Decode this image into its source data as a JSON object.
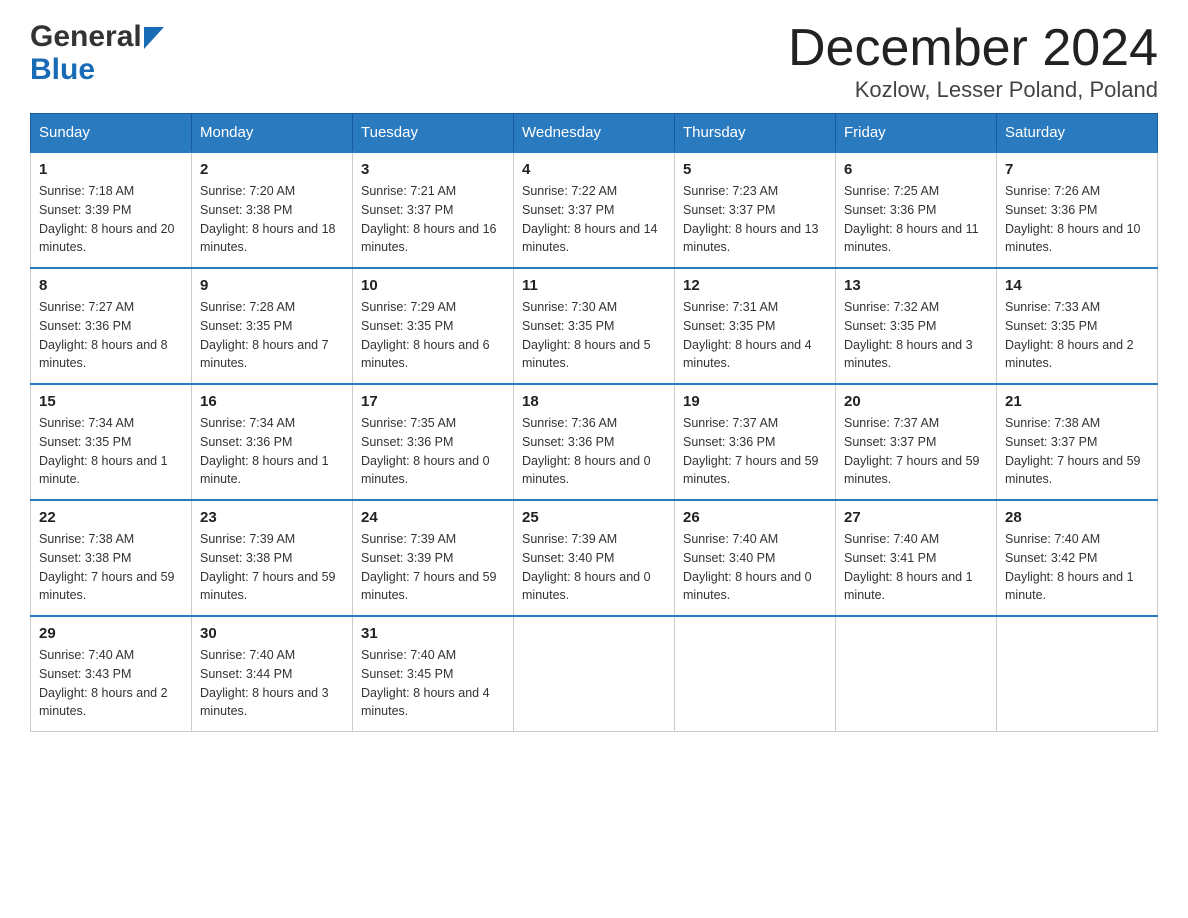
{
  "header": {
    "month_title": "December 2024",
    "location": "Kozlow, Lesser Poland, Poland",
    "logo_general": "General",
    "logo_blue": "Blue"
  },
  "days_of_week": [
    "Sunday",
    "Monday",
    "Tuesday",
    "Wednesday",
    "Thursday",
    "Friday",
    "Saturday"
  ],
  "weeks": [
    [
      {
        "day": "1",
        "sunrise": "Sunrise: 7:18 AM",
        "sunset": "Sunset: 3:39 PM",
        "daylight": "Daylight: 8 hours and 20 minutes."
      },
      {
        "day": "2",
        "sunrise": "Sunrise: 7:20 AM",
        "sunset": "Sunset: 3:38 PM",
        "daylight": "Daylight: 8 hours and 18 minutes."
      },
      {
        "day": "3",
        "sunrise": "Sunrise: 7:21 AM",
        "sunset": "Sunset: 3:37 PM",
        "daylight": "Daylight: 8 hours and 16 minutes."
      },
      {
        "day": "4",
        "sunrise": "Sunrise: 7:22 AM",
        "sunset": "Sunset: 3:37 PM",
        "daylight": "Daylight: 8 hours and 14 minutes."
      },
      {
        "day": "5",
        "sunrise": "Sunrise: 7:23 AM",
        "sunset": "Sunset: 3:37 PM",
        "daylight": "Daylight: 8 hours and 13 minutes."
      },
      {
        "day": "6",
        "sunrise": "Sunrise: 7:25 AM",
        "sunset": "Sunset: 3:36 PM",
        "daylight": "Daylight: 8 hours and 11 minutes."
      },
      {
        "day": "7",
        "sunrise": "Sunrise: 7:26 AM",
        "sunset": "Sunset: 3:36 PM",
        "daylight": "Daylight: 8 hours and 10 minutes."
      }
    ],
    [
      {
        "day": "8",
        "sunrise": "Sunrise: 7:27 AM",
        "sunset": "Sunset: 3:36 PM",
        "daylight": "Daylight: 8 hours and 8 minutes."
      },
      {
        "day": "9",
        "sunrise": "Sunrise: 7:28 AM",
        "sunset": "Sunset: 3:35 PM",
        "daylight": "Daylight: 8 hours and 7 minutes."
      },
      {
        "day": "10",
        "sunrise": "Sunrise: 7:29 AM",
        "sunset": "Sunset: 3:35 PM",
        "daylight": "Daylight: 8 hours and 6 minutes."
      },
      {
        "day": "11",
        "sunrise": "Sunrise: 7:30 AM",
        "sunset": "Sunset: 3:35 PM",
        "daylight": "Daylight: 8 hours and 5 minutes."
      },
      {
        "day": "12",
        "sunrise": "Sunrise: 7:31 AM",
        "sunset": "Sunset: 3:35 PM",
        "daylight": "Daylight: 8 hours and 4 minutes."
      },
      {
        "day": "13",
        "sunrise": "Sunrise: 7:32 AM",
        "sunset": "Sunset: 3:35 PM",
        "daylight": "Daylight: 8 hours and 3 minutes."
      },
      {
        "day": "14",
        "sunrise": "Sunrise: 7:33 AM",
        "sunset": "Sunset: 3:35 PM",
        "daylight": "Daylight: 8 hours and 2 minutes."
      }
    ],
    [
      {
        "day": "15",
        "sunrise": "Sunrise: 7:34 AM",
        "sunset": "Sunset: 3:35 PM",
        "daylight": "Daylight: 8 hours and 1 minute."
      },
      {
        "day": "16",
        "sunrise": "Sunrise: 7:34 AM",
        "sunset": "Sunset: 3:36 PM",
        "daylight": "Daylight: 8 hours and 1 minute."
      },
      {
        "day": "17",
        "sunrise": "Sunrise: 7:35 AM",
        "sunset": "Sunset: 3:36 PM",
        "daylight": "Daylight: 8 hours and 0 minutes."
      },
      {
        "day": "18",
        "sunrise": "Sunrise: 7:36 AM",
        "sunset": "Sunset: 3:36 PM",
        "daylight": "Daylight: 8 hours and 0 minutes."
      },
      {
        "day": "19",
        "sunrise": "Sunrise: 7:37 AM",
        "sunset": "Sunset: 3:36 PM",
        "daylight": "Daylight: 7 hours and 59 minutes."
      },
      {
        "day": "20",
        "sunrise": "Sunrise: 7:37 AM",
        "sunset": "Sunset: 3:37 PM",
        "daylight": "Daylight: 7 hours and 59 minutes."
      },
      {
        "day": "21",
        "sunrise": "Sunrise: 7:38 AM",
        "sunset": "Sunset: 3:37 PM",
        "daylight": "Daylight: 7 hours and 59 minutes."
      }
    ],
    [
      {
        "day": "22",
        "sunrise": "Sunrise: 7:38 AM",
        "sunset": "Sunset: 3:38 PM",
        "daylight": "Daylight: 7 hours and 59 minutes."
      },
      {
        "day": "23",
        "sunrise": "Sunrise: 7:39 AM",
        "sunset": "Sunset: 3:38 PM",
        "daylight": "Daylight: 7 hours and 59 minutes."
      },
      {
        "day": "24",
        "sunrise": "Sunrise: 7:39 AM",
        "sunset": "Sunset: 3:39 PM",
        "daylight": "Daylight: 7 hours and 59 minutes."
      },
      {
        "day": "25",
        "sunrise": "Sunrise: 7:39 AM",
        "sunset": "Sunset: 3:40 PM",
        "daylight": "Daylight: 8 hours and 0 minutes."
      },
      {
        "day": "26",
        "sunrise": "Sunrise: 7:40 AM",
        "sunset": "Sunset: 3:40 PM",
        "daylight": "Daylight: 8 hours and 0 minutes."
      },
      {
        "day": "27",
        "sunrise": "Sunrise: 7:40 AM",
        "sunset": "Sunset: 3:41 PM",
        "daylight": "Daylight: 8 hours and 1 minute."
      },
      {
        "day": "28",
        "sunrise": "Sunrise: 7:40 AM",
        "sunset": "Sunset: 3:42 PM",
        "daylight": "Daylight: 8 hours and 1 minute."
      }
    ],
    [
      {
        "day": "29",
        "sunrise": "Sunrise: 7:40 AM",
        "sunset": "Sunset: 3:43 PM",
        "daylight": "Daylight: 8 hours and 2 minutes."
      },
      {
        "day": "30",
        "sunrise": "Sunrise: 7:40 AM",
        "sunset": "Sunset: 3:44 PM",
        "daylight": "Daylight: 8 hours and 3 minutes."
      },
      {
        "day": "31",
        "sunrise": "Sunrise: 7:40 AM",
        "sunset": "Sunset: 3:45 PM",
        "daylight": "Daylight: 8 hours and 4 minutes."
      },
      null,
      null,
      null,
      null
    ]
  ]
}
